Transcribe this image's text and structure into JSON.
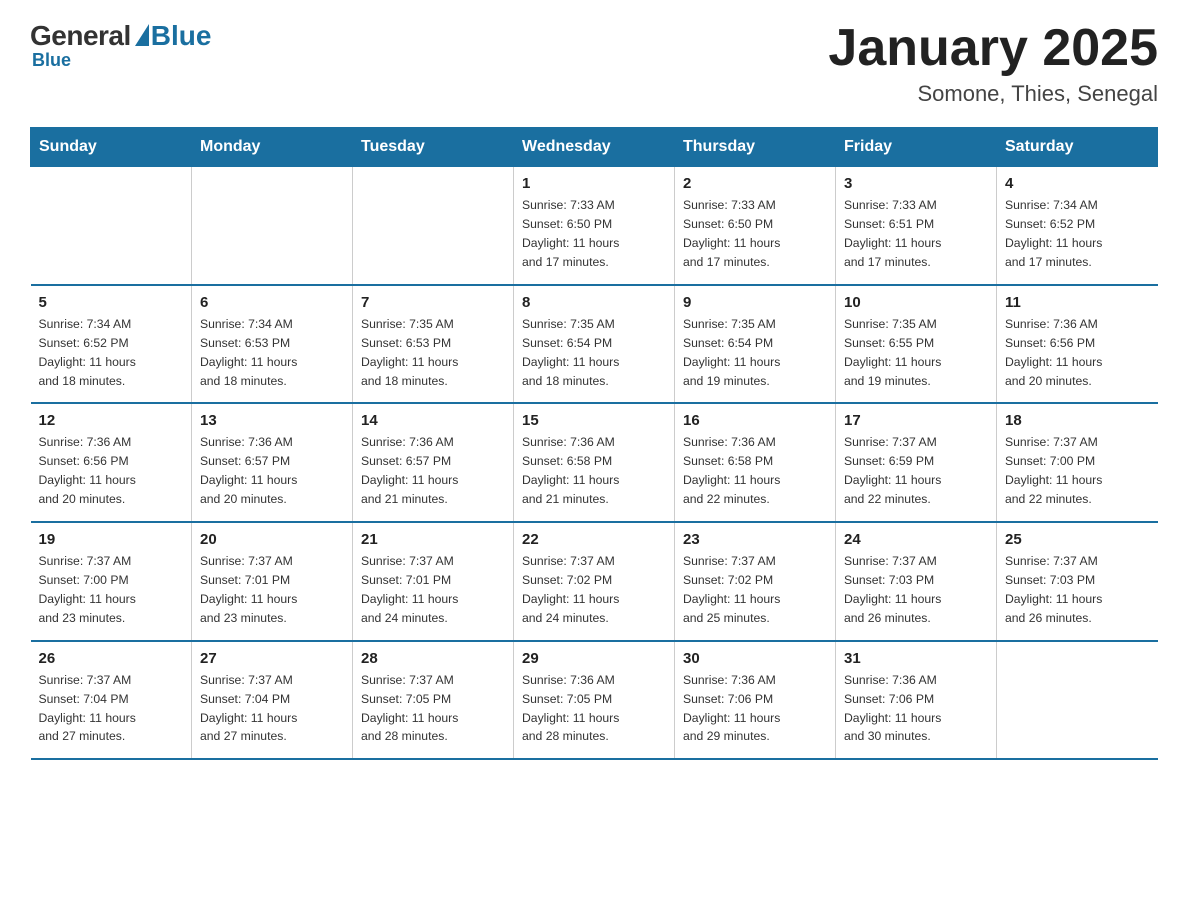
{
  "header": {
    "logo_general": "General",
    "logo_blue": "Blue",
    "title": "January 2025",
    "location": "Somone, Thies, Senegal"
  },
  "days_of_week": [
    "Sunday",
    "Monday",
    "Tuesday",
    "Wednesday",
    "Thursday",
    "Friday",
    "Saturday"
  ],
  "weeks": [
    [
      {
        "day": "",
        "info": ""
      },
      {
        "day": "",
        "info": ""
      },
      {
        "day": "",
        "info": ""
      },
      {
        "day": "1",
        "info": "Sunrise: 7:33 AM\nSunset: 6:50 PM\nDaylight: 11 hours\nand 17 minutes."
      },
      {
        "day": "2",
        "info": "Sunrise: 7:33 AM\nSunset: 6:50 PM\nDaylight: 11 hours\nand 17 minutes."
      },
      {
        "day": "3",
        "info": "Sunrise: 7:33 AM\nSunset: 6:51 PM\nDaylight: 11 hours\nand 17 minutes."
      },
      {
        "day": "4",
        "info": "Sunrise: 7:34 AM\nSunset: 6:52 PM\nDaylight: 11 hours\nand 17 minutes."
      }
    ],
    [
      {
        "day": "5",
        "info": "Sunrise: 7:34 AM\nSunset: 6:52 PM\nDaylight: 11 hours\nand 18 minutes."
      },
      {
        "day": "6",
        "info": "Sunrise: 7:34 AM\nSunset: 6:53 PM\nDaylight: 11 hours\nand 18 minutes."
      },
      {
        "day": "7",
        "info": "Sunrise: 7:35 AM\nSunset: 6:53 PM\nDaylight: 11 hours\nand 18 minutes."
      },
      {
        "day": "8",
        "info": "Sunrise: 7:35 AM\nSunset: 6:54 PM\nDaylight: 11 hours\nand 18 minutes."
      },
      {
        "day": "9",
        "info": "Sunrise: 7:35 AM\nSunset: 6:54 PM\nDaylight: 11 hours\nand 19 minutes."
      },
      {
        "day": "10",
        "info": "Sunrise: 7:35 AM\nSunset: 6:55 PM\nDaylight: 11 hours\nand 19 minutes."
      },
      {
        "day": "11",
        "info": "Sunrise: 7:36 AM\nSunset: 6:56 PM\nDaylight: 11 hours\nand 20 minutes."
      }
    ],
    [
      {
        "day": "12",
        "info": "Sunrise: 7:36 AM\nSunset: 6:56 PM\nDaylight: 11 hours\nand 20 minutes."
      },
      {
        "day": "13",
        "info": "Sunrise: 7:36 AM\nSunset: 6:57 PM\nDaylight: 11 hours\nand 20 minutes."
      },
      {
        "day": "14",
        "info": "Sunrise: 7:36 AM\nSunset: 6:57 PM\nDaylight: 11 hours\nand 21 minutes."
      },
      {
        "day": "15",
        "info": "Sunrise: 7:36 AM\nSunset: 6:58 PM\nDaylight: 11 hours\nand 21 minutes."
      },
      {
        "day": "16",
        "info": "Sunrise: 7:36 AM\nSunset: 6:58 PM\nDaylight: 11 hours\nand 22 minutes."
      },
      {
        "day": "17",
        "info": "Sunrise: 7:37 AM\nSunset: 6:59 PM\nDaylight: 11 hours\nand 22 minutes."
      },
      {
        "day": "18",
        "info": "Sunrise: 7:37 AM\nSunset: 7:00 PM\nDaylight: 11 hours\nand 22 minutes."
      }
    ],
    [
      {
        "day": "19",
        "info": "Sunrise: 7:37 AM\nSunset: 7:00 PM\nDaylight: 11 hours\nand 23 minutes."
      },
      {
        "day": "20",
        "info": "Sunrise: 7:37 AM\nSunset: 7:01 PM\nDaylight: 11 hours\nand 23 minutes."
      },
      {
        "day": "21",
        "info": "Sunrise: 7:37 AM\nSunset: 7:01 PM\nDaylight: 11 hours\nand 24 minutes."
      },
      {
        "day": "22",
        "info": "Sunrise: 7:37 AM\nSunset: 7:02 PM\nDaylight: 11 hours\nand 24 minutes."
      },
      {
        "day": "23",
        "info": "Sunrise: 7:37 AM\nSunset: 7:02 PM\nDaylight: 11 hours\nand 25 minutes."
      },
      {
        "day": "24",
        "info": "Sunrise: 7:37 AM\nSunset: 7:03 PM\nDaylight: 11 hours\nand 26 minutes."
      },
      {
        "day": "25",
        "info": "Sunrise: 7:37 AM\nSunset: 7:03 PM\nDaylight: 11 hours\nand 26 minutes."
      }
    ],
    [
      {
        "day": "26",
        "info": "Sunrise: 7:37 AM\nSunset: 7:04 PM\nDaylight: 11 hours\nand 27 minutes."
      },
      {
        "day": "27",
        "info": "Sunrise: 7:37 AM\nSunset: 7:04 PM\nDaylight: 11 hours\nand 27 minutes."
      },
      {
        "day": "28",
        "info": "Sunrise: 7:37 AM\nSunset: 7:05 PM\nDaylight: 11 hours\nand 28 minutes."
      },
      {
        "day": "29",
        "info": "Sunrise: 7:36 AM\nSunset: 7:05 PM\nDaylight: 11 hours\nand 28 minutes."
      },
      {
        "day": "30",
        "info": "Sunrise: 7:36 AM\nSunset: 7:06 PM\nDaylight: 11 hours\nand 29 minutes."
      },
      {
        "day": "31",
        "info": "Sunrise: 7:36 AM\nSunset: 7:06 PM\nDaylight: 11 hours\nand 30 minutes."
      },
      {
        "day": "",
        "info": ""
      }
    ]
  ]
}
